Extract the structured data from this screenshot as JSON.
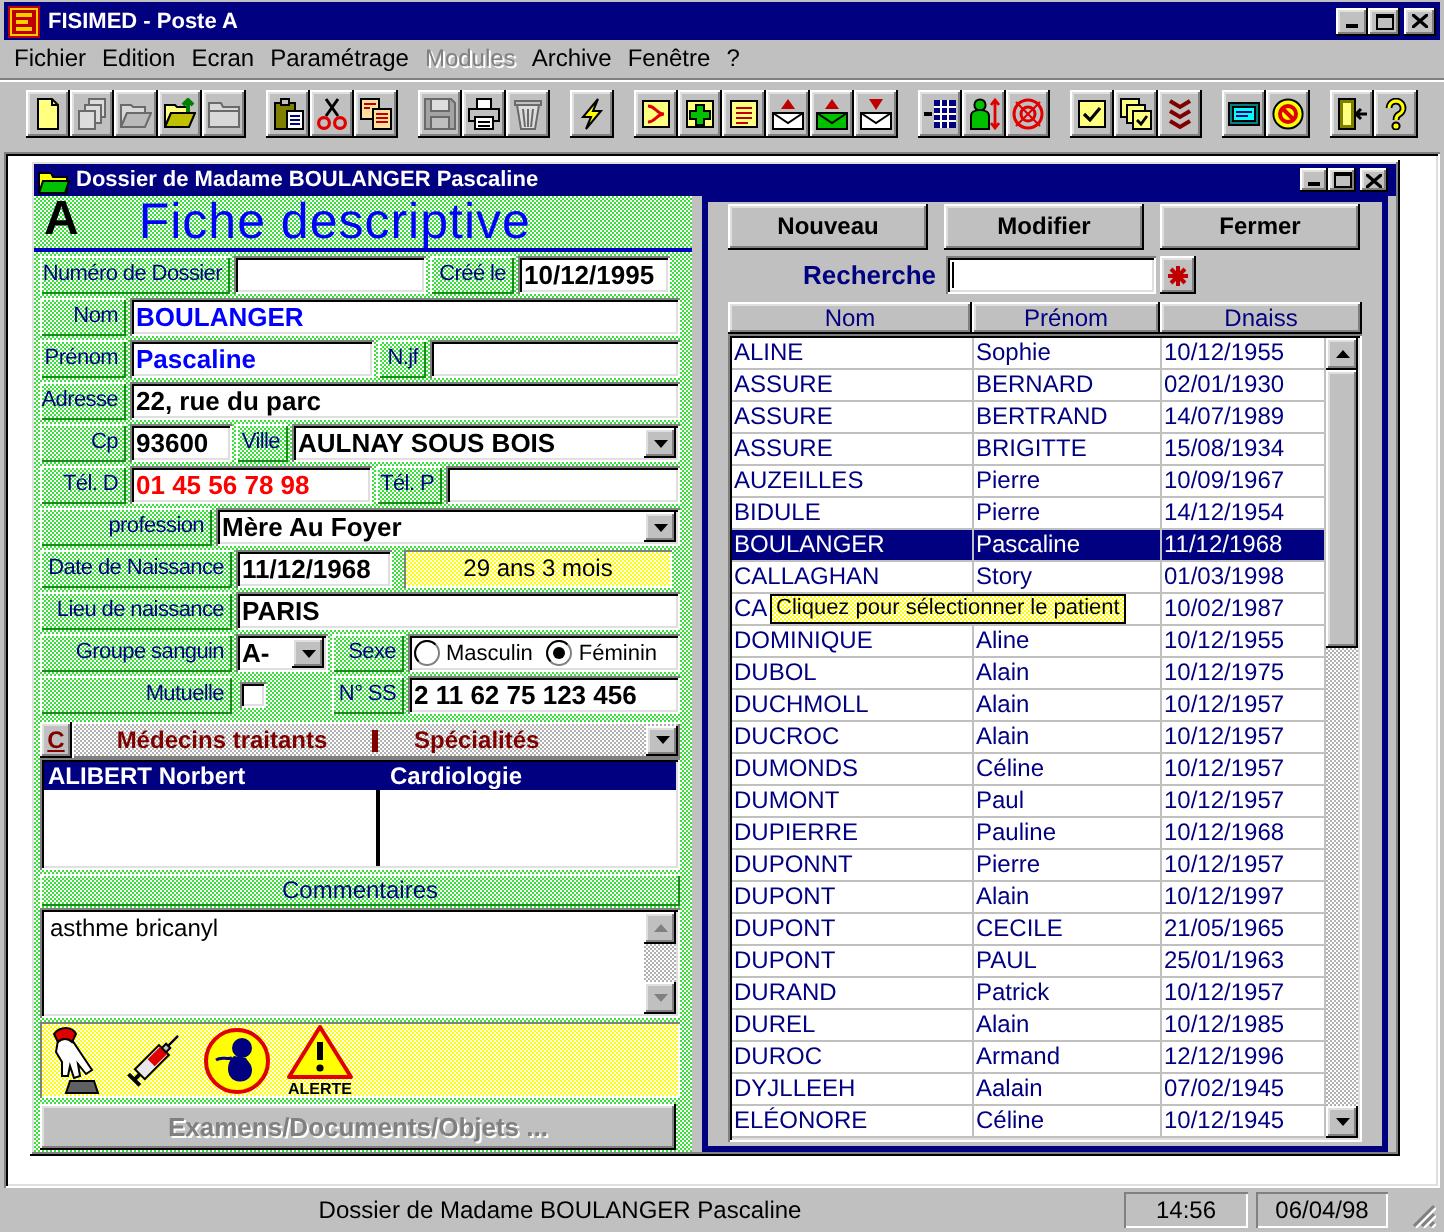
{
  "window": {
    "title": "FISIMED - Poste A"
  },
  "menu": [
    {
      "label": "Fichier",
      "disabled": false
    },
    {
      "label": "Edition",
      "disabled": false
    },
    {
      "label": "Ecran",
      "disabled": false
    },
    {
      "label": "Paramétrage",
      "disabled": false
    },
    {
      "label": "Modules",
      "disabled": true
    },
    {
      "label": "Archive",
      "disabled": false
    },
    {
      "label": "Fenêtre",
      "disabled": false
    },
    {
      "label": "?",
      "disabled": false
    }
  ],
  "toolbar": [
    {
      "buttons": [
        {
          "kind": "new",
          "disabled": false
        },
        {
          "kind": "copies",
          "disabled": true
        },
        {
          "kind": "open",
          "disabled": true
        },
        {
          "kind": "import",
          "disabled": false
        },
        {
          "kind": "folder",
          "disabled": true
        }
      ]
    },
    {
      "buttons": [
        {
          "kind": "paste",
          "disabled": false
        },
        {
          "kind": "cut",
          "disabled": false
        },
        {
          "kind": "copy",
          "disabled": false
        }
      ]
    },
    {
      "buttons": [
        {
          "kind": "save",
          "disabled": true
        },
        {
          "kind": "print",
          "disabled": false
        },
        {
          "kind": "trash",
          "disabled": true
        }
      ]
    },
    {
      "buttons": [
        {
          "kind": "flash",
          "disabled": false
        }
      ]
    },
    {
      "buttons": [
        {
          "kind": "note",
          "disabled": false
        },
        {
          "kind": "cross",
          "disabled": false
        },
        {
          "kind": "page",
          "disabled": false
        },
        {
          "kind": "mailout",
          "disabled": false
        },
        {
          "kind": "mailgreen",
          "disabled": false
        },
        {
          "kind": "mailin",
          "disabled": false
        }
      ]
    },
    {
      "buttons": [
        {
          "kind": "grid",
          "disabled": false
        },
        {
          "kind": "person",
          "disabled": false
        },
        {
          "kind": "target",
          "disabled": false
        }
      ]
    },
    {
      "buttons": [
        {
          "kind": "check",
          "disabled": false
        },
        {
          "kind": "checks",
          "disabled": false
        },
        {
          "kind": "chevrons",
          "disabled": false
        }
      ]
    },
    {
      "buttons": [
        {
          "kind": "monitor",
          "disabled": false
        },
        {
          "kind": "sign",
          "disabled": false
        }
      ]
    },
    {
      "buttons": [
        {
          "kind": "exit",
          "disabled": false
        },
        {
          "kind": "help",
          "disabled": false
        }
      ]
    }
  ],
  "document_window": {
    "title": "Dossier de Madame BOULANGER Pascaline",
    "form": {
      "letter": "A",
      "heading": "Fiche descriptive",
      "rows": [
        {
          "fields": [
            {
              "label": "Numéro de Dossier",
              "kind": "text"
            },
            {
              "label": "Créé le",
              "kind": "date",
              "value": "10/12/1995"
            }
          ]
        },
        {
          "fields": [
            {
              "label": "Nom",
              "kind": "text",
              "value": "BOULANGER",
              "color": "#0000ff"
            }
          ]
        },
        {
          "fields": [
            {
              "label": "Prénom",
              "kind": "text",
              "value": "Pascaline",
              "color": "#0000ff"
            },
            {
              "label": "N.jf",
              "kind": "text"
            }
          ]
        },
        {
          "fields": [
            {
              "label": "Adresse",
              "kind": "text",
              "value": "22, rue du parc"
            }
          ]
        },
        {
          "fields": [
            {
              "label": "Cp",
              "kind": "text",
              "value": "93600"
            },
            {
              "label": "Ville",
              "kind": "combo",
              "value": "AULNAY SOUS BOIS"
            }
          ]
        },
        {
          "fields": [
            {
              "label": "Tél. D",
              "kind": "text",
              "value": "01 45 56 78 98",
              "color": "#ff0000"
            },
            {
              "label": "Tél. P",
              "kind": "text"
            }
          ]
        },
        {
          "fields": [
            {
              "label": "profession",
              "kind": "combo",
              "value": "Mère Au Foyer"
            }
          ]
        },
        {
          "fields": [
            {
              "label": "Date de Naissance",
              "kind": "text",
              "value": "11/12/1968"
            },
            {
              "kind": "age",
              "value": "29 ans 3 mois"
            }
          ]
        },
        {
          "fields": [
            {
              "label": "Lieu de naissance",
              "kind": "text",
              "value": "PARIS"
            }
          ]
        },
        {
          "fields": [
            {
              "label": "Groupe sanguin",
              "kind": "combo",
              "value": "A-"
            },
            {
              "label": "Sexe",
              "kind": "radio",
              "options": [
                {
                  "label": "Masculin",
                  "selected": false
                },
                {
                  "label": "Féminin",
                  "selected": true
                }
              ]
            }
          ]
        },
        {
          "fields": [
            {
              "label": "Mutuelle",
              "kind": "checkbox",
              "checked": false
            },
            {
              "label": "N° SS",
              "kind": "text",
              "value": "2 11 62 75 123 456"
            }
          ]
        }
      ],
      "doctors": {
        "button": "C",
        "columns": [
          "Médecins traitants",
          "Spécialités"
        ],
        "rows": [
          {
            "cells": [
              "ALIBERT Norbert",
              "Cardiologie"
            ],
            "selected": true
          }
        ]
      },
      "comments": {
        "label": "Commentaires",
        "value": "asthme bricanyl"
      },
      "icons": [
        {
          "kind": "hand"
        },
        {
          "kind": "syringe"
        },
        {
          "kind": "fetus"
        },
        {
          "kind": "alert",
          "label": "ALERTE"
        }
      ],
      "documents_button": {
        "label": "Examens/Documents/Objets ...",
        "disabled": true
      }
    },
    "patients": {
      "buttons": [
        "Nouveau",
        "Modifier",
        "Fermer"
      ],
      "search": {
        "label": "Recherche",
        "focused": true
      },
      "columns": [
        "Nom",
        "Prénom",
        "Dnaiss"
      ],
      "rows": [
        {
          "nom": "ALINE",
          "prenom": "Sophie",
          "dnaiss": "10/12/1955",
          "selected": false
        },
        {
          "nom": "ASSURE",
          "prenom": "BERNARD",
          "dnaiss": "02/01/1930",
          "selected": false
        },
        {
          "nom": "ASSURE",
          "prenom": "BERTRAND",
          "dnaiss": "14/07/1989",
          "selected": false
        },
        {
          "nom": "ASSURE",
          "prenom": "BRIGITTE",
          "dnaiss": "15/08/1934",
          "selected": false
        },
        {
          "nom": "AUZEILLES",
          "prenom": "Pierre",
          "dnaiss": "10/09/1967",
          "selected": false
        },
        {
          "nom": "BIDULE",
          "prenom": "Pierre",
          "dnaiss": "14/12/1954",
          "selected": false
        },
        {
          "nom": "BOULANGER",
          "prenom": "Pascaline",
          "dnaiss": "11/12/1968",
          "selected": true
        },
        {
          "nom": "CALLAGHAN",
          "prenom": "Story",
          "dnaiss": "01/03/1998",
          "selected": false
        },
        {
          "nom": "CA",
          "dnaiss": "10/02/1987",
          "selected": false
        },
        {
          "nom": "DOMINIQUE",
          "prenom": "Aline",
          "dnaiss": "10/12/1955",
          "selected": false
        },
        {
          "nom": "DUBOL",
          "prenom": "Alain",
          "dnaiss": "10/12/1975",
          "selected": false
        },
        {
          "nom": "DUCHMOLL",
          "prenom": "Alain",
          "dnaiss": "10/12/1957",
          "selected": false
        },
        {
          "nom": "DUCROC",
          "prenom": "Alain",
          "dnaiss": "10/12/1957",
          "selected": false
        },
        {
          "nom": "DUMONDS",
          "prenom": "Céline",
          "dnaiss": "10/12/1957",
          "selected": false
        },
        {
          "nom": "DUMONT",
          "prenom": "Paul",
          "dnaiss": "10/12/1957",
          "selected": false
        },
        {
          "nom": "DUPIERRE",
          "prenom": "Pauline",
          "dnaiss": "10/12/1968",
          "selected": false
        },
        {
          "nom": "DUPONNT",
          "prenom": "Pierre",
          "dnaiss": "10/12/1957",
          "selected": false
        },
        {
          "nom": "DUPONT",
          "prenom": "Alain",
          "dnaiss": "10/12/1997",
          "selected": false
        },
        {
          "nom": "DUPONT",
          "prenom": "CECILE",
          "dnaiss": "21/05/1965",
          "selected": false
        },
        {
          "nom": "DUPONT",
          "prenom": "PAUL",
          "dnaiss": "25/01/1963",
          "selected": false
        },
        {
          "nom": "DURAND",
          "prenom": "Patrick",
          "dnaiss": "10/12/1957",
          "selected": false
        },
        {
          "nom": "DUREL",
          "prenom": "Alain",
          "dnaiss": "10/12/1985",
          "selected": false
        },
        {
          "nom": "DUROC",
          "prenom": "Armand",
          "dnaiss": "12/12/1996",
          "selected": false
        },
        {
          "nom": "DYJLLEEH",
          "prenom": "Aalain",
          "dnaiss": "07/02/1945",
          "selected": false
        },
        {
          "nom": "ELÉONORE",
          "prenom": "Céline",
          "dnaiss": "10/12/1945",
          "selected": false
        }
      ],
      "tooltip": "Cliquez pour sélectionner le patient"
    }
  },
  "status_bar": {
    "text": "Dossier de Madame BOULANGER Pascaline",
    "time": "14:56",
    "date": "06/04/98"
  }
}
